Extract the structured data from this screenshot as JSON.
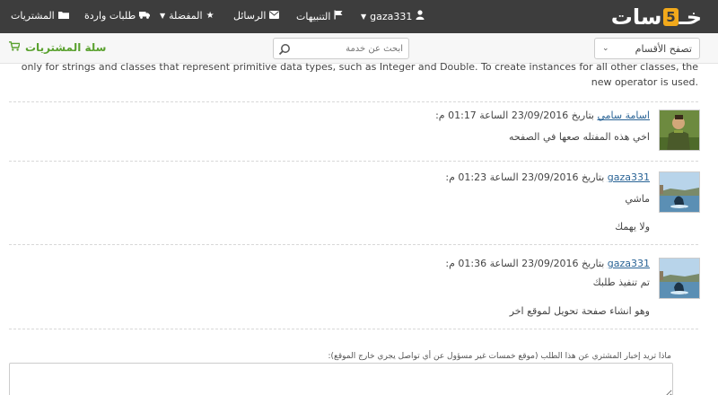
{
  "topbar": {
    "logo_pre": "خـ",
    "logo_five": "5",
    "logo_post": "سات",
    "username": "gaza331",
    "notifications": "التنبيهات",
    "messages": "الرسائل",
    "favorites": "المفضلة",
    "incoming": "طلبات واردة",
    "purchases": "المشتريات"
  },
  "subbar": {
    "browse_label": "تصفح الأقسام",
    "search_placeholder": "ابحث عن خدمة",
    "cart_label": "سلة المشتريات"
  },
  "content": {
    "note_line1": "is available only for strings and classes that represent primitive data types, such as Integer and Double. To create instances for all other classes, the",
    "note_line2": ".new operator is used"
  },
  "comments": [
    {
      "author": "اسامة سامي",
      "meta": " بتاريخ 23/09/2016 الساعة 01:17 م:",
      "lines": [
        "اخي هذه المفتله صعها في الصفحه"
      ]
    },
    {
      "author": "gaza331",
      "meta": " بتاريخ 23/09/2016 الساعة 01:23 م:",
      "lines": [
        "ماشي",
        "ولا يهمك"
      ]
    },
    {
      "author": "gaza331",
      "meta": " بتاريخ 23/09/2016 الساعة 01:36 م:",
      "lines": [
        "تم تنفيذ طلبك",
        "وهو انشاء صفحة تحويل لموقع اخر"
      ]
    }
  ],
  "reply": {
    "warning": "ماذا تريد إخبار المشتري عن هذا الطلب (موقع خمسات غير مسؤول عن أي تواصل يجري خارج الموقع):"
  }
}
